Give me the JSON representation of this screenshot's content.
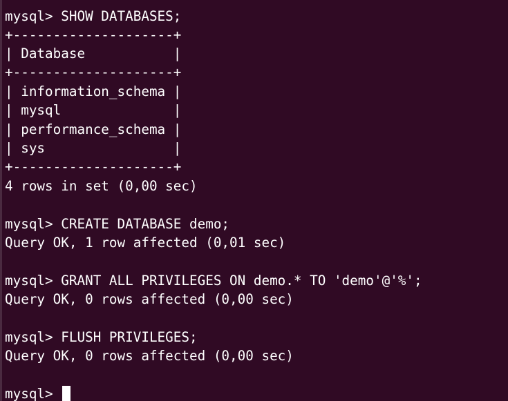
{
  "terminal": {
    "lines": [
      "mysql> SHOW DATABASES;",
      "+--------------------+",
      "| Database           |",
      "+--------------------+",
      "| information_schema |",
      "| mysql              |",
      "| performance_schema |",
      "| sys                |",
      "+--------------------+",
      "4 rows in set (0,00 sec)",
      "",
      "mysql> CREATE DATABASE demo;",
      "Query OK, 1 row affected (0,01 sec)",
      "",
      "mysql> GRANT ALL PRIVILEGES ON demo.* TO 'demo'@'%';",
      "Query OK, 0 rows affected (0,00 sec)",
      "",
      "mysql> FLUSH PRIVILEGES;",
      "Query OK, 0 rows affected (0,00 sec)",
      "",
      "mysql> "
    ],
    "colors": {
      "background": "#300a24",
      "foreground": "#ffffff"
    }
  }
}
